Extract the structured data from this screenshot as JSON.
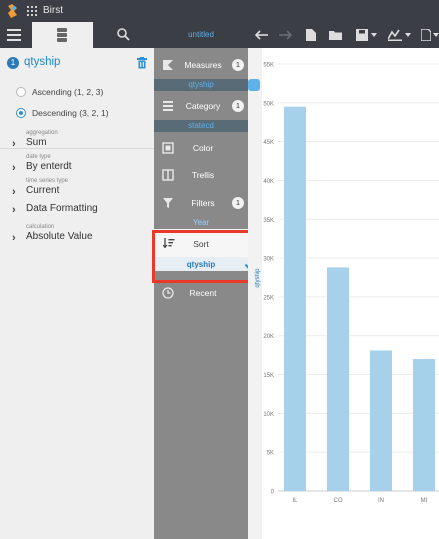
{
  "app": {
    "title": "Birst",
    "untitled": "untitled"
  },
  "left": {
    "field_badge": "1",
    "field_name": "qtyship",
    "sort_options": [
      "Ascending (1, 2, 3)",
      "Descending (3, 2, 1)"
    ],
    "selected_sort_index": 1,
    "props": [
      {
        "small": "aggregation",
        "value": "Sum"
      },
      {
        "small": "date type",
        "value": "By enterdt"
      },
      {
        "small": "time series type",
        "value": "Current"
      },
      {
        "small": "",
        "value": "Data Formatting"
      },
      {
        "small": "calculation",
        "value": "Absolute Value"
      }
    ]
  },
  "shelves": {
    "measures": {
      "label": "Measures",
      "count": "1",
      "pill": "qtyship"
    },
    "category": {
      "label": "Category",
      "count": "1",
      "pill": "statecd"
    },
    "color": {
      "label": "Color"
    },
    "trellis": {
      "label": "Trellis"
    },
    "filters": {
      "label": "Filters",
      "count": "1",
      "pill": "Year"
    },
    "sort": {
      "label": "Sort",
      "pill": "qtyship"
    },
    "recent": {
      "label": "Recent"
    }
  },
  "colors": {
    "bar": "#a7d0ea",
    "accent": "#2a7ab8",
    "highlight": "#e8392a"
  },
  "chart_data": {
    "type": "bar",
    "categories": [
      "IL",
      "CO",
      "IN",
      "MI"
    ],
    "values": [
      49500,
      28800,
      18100,
      17000
    ],
    "ylim": [
      0,
      55000
    ],
    "yticks": [
      0,
      5000,
      10000,
      15000,
      20000,
      25000,
      30000,
      35000,
      40000,
      45000,
      50000,
      55000
    ],
    "ytick_labels": [
      "0",
      "5K",
      "10K",
      "15K",
      "20K",
      "25K",
      "30K",
      "35K",
      "40K",
      "45K",
      "50K",
      "55K"
    ],
    "ylabel": "qtyship",
    "grid": true
  }
}
